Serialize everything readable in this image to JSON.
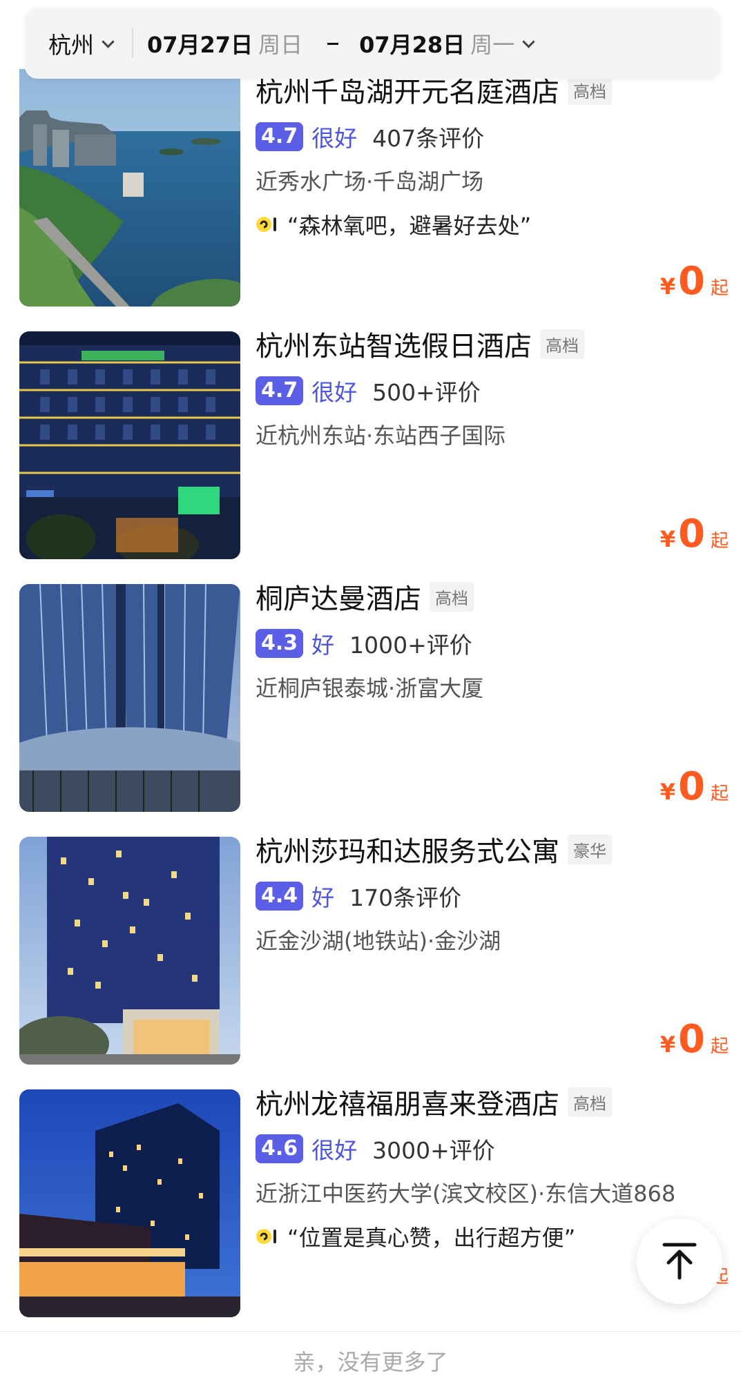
{
  "search": {
    "city": "杭州",
    "checkin_date": "07月27日",
    "checkin_weekday": "周日",
    "checkout_date": "07月28日",
    "checkout_weekday": "周一"
  },
  "hotels": [
    {
      "name": "杭州千岛湖开元名庭酒店",
      "grade": "高档",
      "score": "4.7",
      "score_label": "很好",
      "reviews": "407条评价",
      "location": "近秀水广场·千岛湖广场",
      "quote": "“森林氧吧，避暑好去处”",
      "price_symbol": "¥",
      "price": "0",
      "price_suffix": "起"
    },
    {
      "name": "杭州东站智选假日酒店",
      "grade": "高档",
      "score": "4.7",
      "score_label": "很好",
      "reviews": "500+评价",
      "location": "近杭州东站·东站西子国际",
      "price_symbol": "¥",
      "price": "0",
      "price_suffix": "起"
    },
    {
      "name": "桐庐达曼酒店",
      "grade": "高档",
      "score": "4.3",
      "score_label": "好",
      "reviews": "1000+评价",
      "location": "近桐庐银泰城·浙富大厦",
      "price_symbol": "¥",
      "price": "0",
      "price_suffix": "起"
    },
    {
      "name": "杭州莎玛和达服务式公寓",
      "grade": "豪华",
      "score": "4.4",
      "score_label": "好",
      "reviews": "170条评价",
      "location": "近金沙湖(地铁站)·金沙湖",
      "price_symbol": "¥",
      "price": "0",
      "price_suffix": "起"
    },
    {
      "name": "杭州龙禧福朋喜来登酒店",
      "grade": "高档",
      "score": "4.6",
      "score_label": "很好",
      "reviews": "3000+评价",
      "location": "近浙江中医药大学(滨文校区)·东信大道868",
      "quote": "“位置是真心赞，出行超方便”",
      "price_symbol": "¥",
      "price": "0",
      "price_suffix": "起"
    }
  ],
  "footer": {
    "end_text": "亲，没有更多了"
  },
  "colors": {
    "score_badge": "#5b5fe8",
    "score_label": "#4d55dd",
    "price": "#ff5a1f"
  },
  "icons": {
    "city_dropdown": "chevron-down-icon",
    "date_dropdown": "chevron-down-icon",
    "quote": "quote-mark-icon",
    "back_to_top": "arrow-up-icon"
  }
}
